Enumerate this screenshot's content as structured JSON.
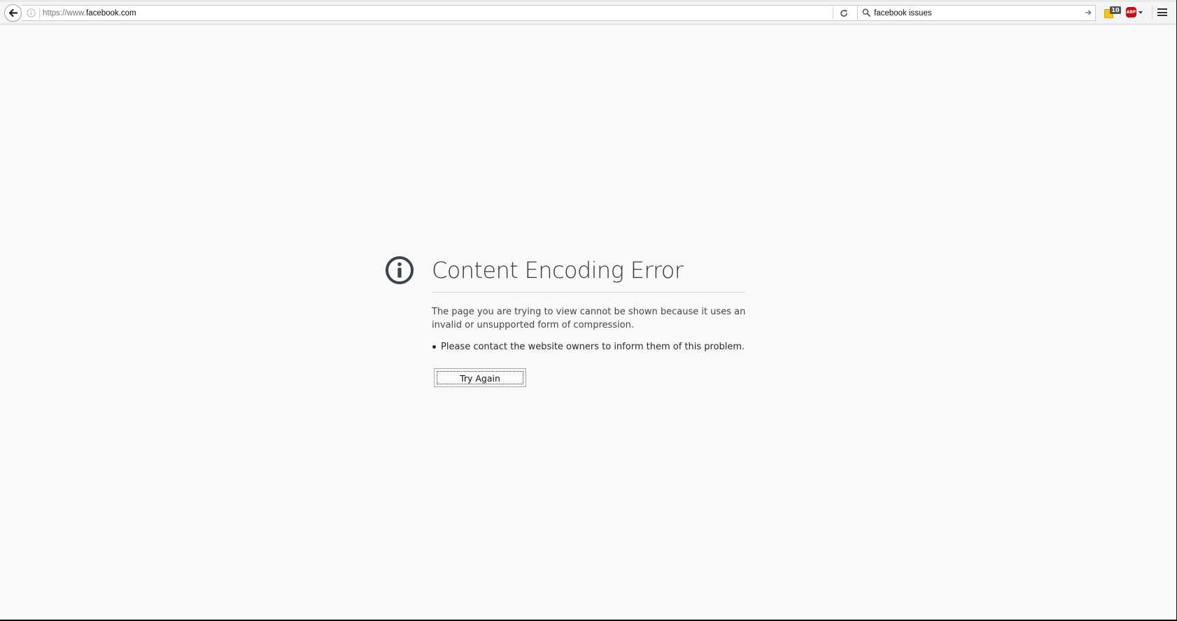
{
  "browser": {
    "url_prefix": "https://www.",
    "url_host": "facebook.com",
    "search_value": "facebook issues",
    "extension_badge_count": "10",
    "abp_label": "ABP",
    "icons": {
      "back": "back-arrow-icon",
      "site_info": "info-icon",
      "reload": "reload-icon",
      "search": "search-icon",
      "search_go": "arrow-right-icon",
      "notes_extension": "sticky-note-icon",
      "adblock": "adblock-icon",
      "menu": "hamburger-menu-icon"
    }
  },
  "error": {
    "icon": "info-circle-icon",
    "title": "Content Encoding Error",
    "description": "The page you are trying to view cannot be shown because it uses an invalid or unsupported form of compression.",
    "bullets": [
      "Please contact the website owners to inform them of this problem."
    ],
    "button_label": "Try Again"
  },
  "colors": {
    "page_background": "#f9f9fa",
    "title_text": "#3a3a3e",
    "icon": "#3a4450",
    "abp_red": "#c70d0d",
    "notes_yellow": "#f5c518"
  }
}
